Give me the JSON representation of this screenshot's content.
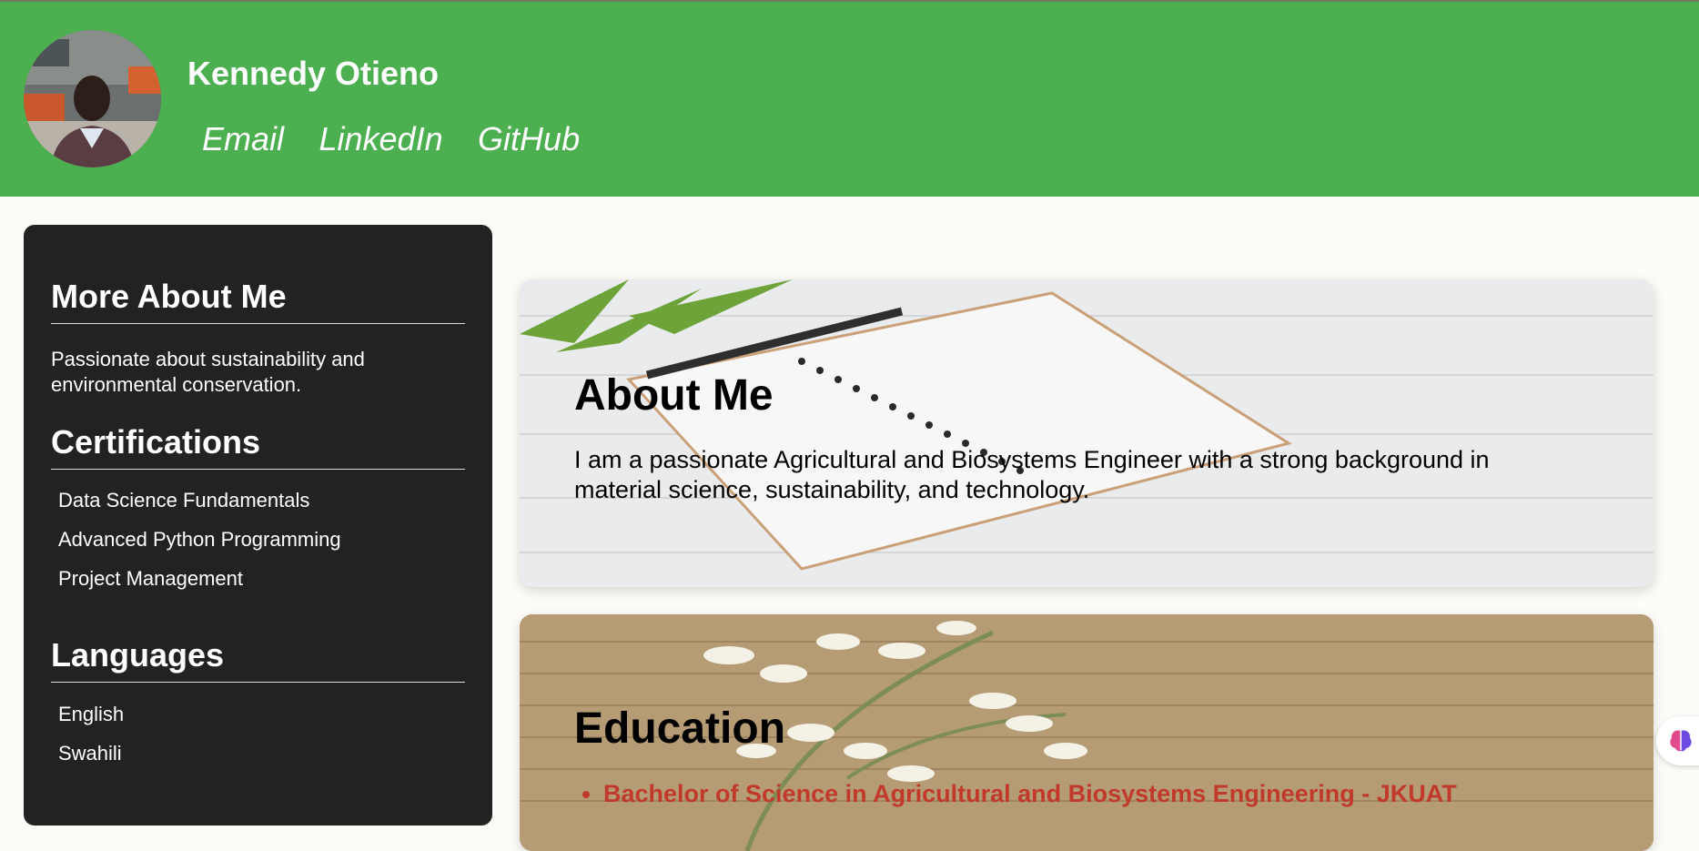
{
  "header": {
    "name": "Kennedy Otieno",
    "links": [
      {
        "label": "Email"
      },
      {
        "label": "LinkedIn"
      },
      {
        "label": "GitHub"
      }
    ]
  },
  "sidebar": {
    "about_title": "More About Me",
    "about_text": "Passionate about sustainability and environmental conservation.",
    "certifications_title": "Certifications",
    "certifications": [
      "Data Science Fundamentals",
      "Advanced Python Programming",
      "Project Management"
    ],
    "languages_title": "Languages",
    "languages": [
      "English",
      "Swahili"
    ]
  },
  "about": {
    "title": "About Me",
    "text": "I am a passionate Agricultural and Biosystems Engineer with a strong background in material science, sustainability, and technology."
  },
  "education": {
    "title": "Education",
    "items": [
      "Bachelor of Science in Agricultural and Biosystems Engineering - JKUAT"
    ]
  },
  "icons": {
    "avatar": "profile-photo",
    "widget": "brain-icon"
  },
  "colors": {
    "header": "#4caf50",
    "sidebar": "#222222",
    "education_item": "#c0392b"
  }
}
